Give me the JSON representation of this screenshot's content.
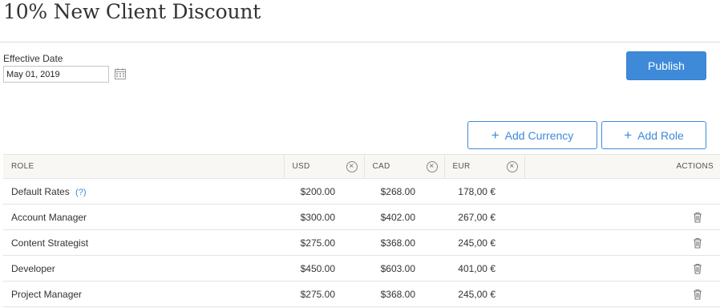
{
  "page": {
    "title": "10% New Client Discount"
  },
  "effective_date": {
    "label": "Effective Date",
    "value": "May 01, 2019"
  },
  "buttons": {
    "publish": "Publish",
    "add_currency": "Add Currency",
    "add_role": "Add Role"
  },
  "icons": {
    "calendar": "calendar-icon",
    "remove": "remove-column-icon",
    "trash": "trash-icon",
    "plus": "plus-icon"
  },
  "table": {
    "headers": {
      "role": "ROLE",
      "usd": "USD",
      "cad": "CAD",
      "eur": "EUR",
      "actions": "ACTIONS"
    },
    "help_text": "(?)",
    "rows": [
      {
        "role": "Default Rates",
        "usd": "$200.00",
        "cad": "$268.00",
        "eur": "178,00 €"
      },
      {
        "role": "Account Manager",
        "usd": "$300.00",
        "cad": "$402.00",
        "eur": "267,00 €"
      },
      {
        "role": "Content Strategist",
        "usd": "$275.00",
        "cad": "$368.00",
        "eur": "245,00 €"
      },
      {
        "role": "Developer",
        "usd": "$450.00",
        "cad": "$603.00",
        "eur": "401,00 €"
      },
      {
        "role": "Project Manager",
        "usd": "$275.00",
        "cad": "$368.00",
        "eur": "245,00 €"
      }
    ]
  },
  "colors": {
    "accent": "#3e8ad9",
    "header_bg": "#f8f7f4",
    "border": "#e4e4e4"
  }
}
